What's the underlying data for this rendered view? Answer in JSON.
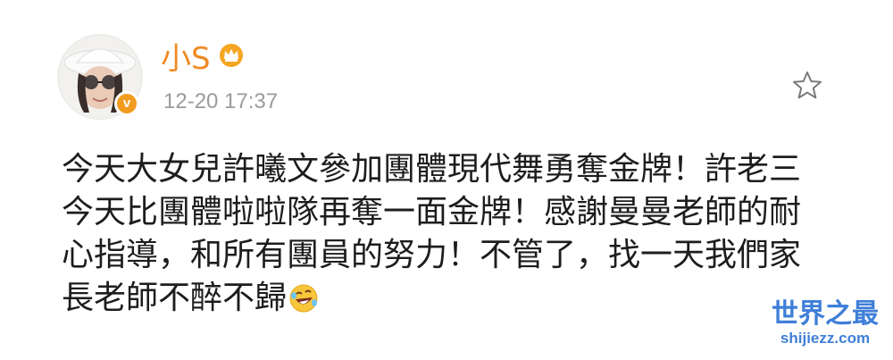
{
  "post": {
    "author": {
      "name": "小S",
      "verified": true,
      "verified_badge_letter": "v",
      "badge_color": "#f29c1f",
      "name_color": "#f08a24",
      "member_icon": "crown-member-icon",
      "avatar": "user-avatar"
    },
    "timestamp": "12-20 17:37",
    "lines": [
      "今天大女兒許曦文參加團體現代舞勇奪金牌！許老三",
      "今天比團體啦啦隊再奪一面金牌！感謝曼曼老師的耐",
      "心指導，和所有團員的努力！不管了，找一天我們家",
      "長老師不醉不歸"
    ],
    "trailing_emoji": "rolling-laughing-emoji-icon",
    "actions": {
      "favorite_icon": "star-icon"
    }
  },
  "watermark": {
    "title": "世界之最",
    "url": "shijiezz.com",
    "color": "#3f7fd8"
  }
}
